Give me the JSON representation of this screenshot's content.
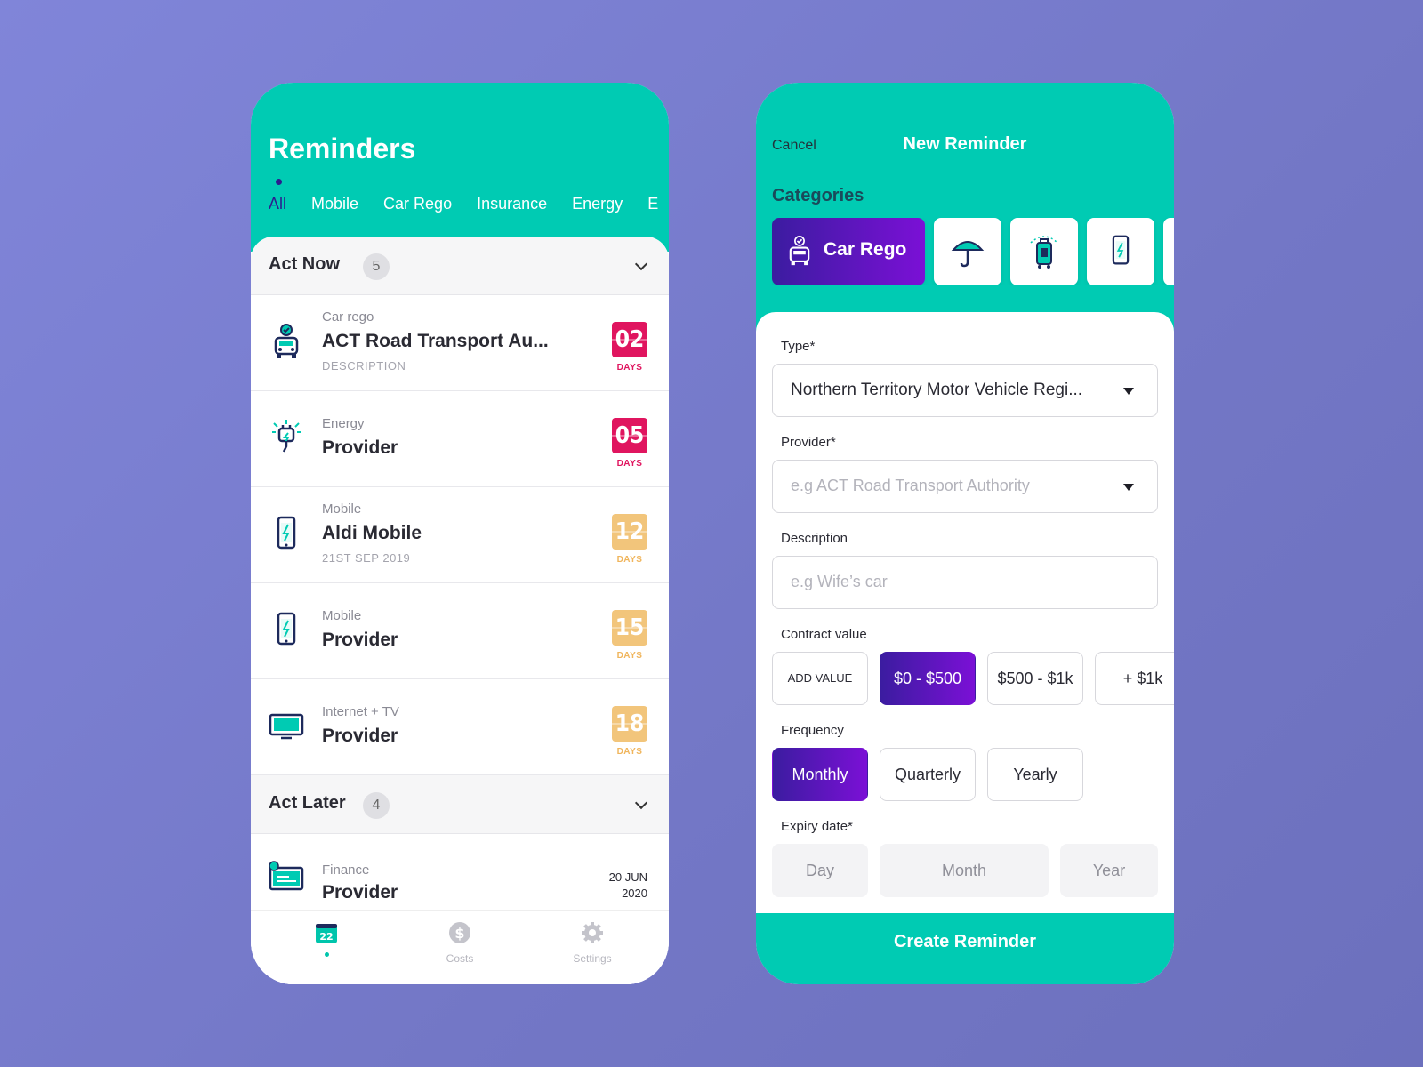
{
  "left": {
    "title": "Reminders",
    "tabs": [
      "All",
      "Mobile",
      "Car Rego",
      "Insurance",
      "Energy",
      "E"
    ],
    "act_now": {
      "title": "Act Now",
      "count": "5"
    },
    "act_later": {
      "title": "Act Later",
      "count": "4"
    },
    "rows": [
      {
        "category": "Car rego",
        "title": "ACT Road Transport Au...",
        "subtitle": "DESCRIPTION",
        "days": "02",
        "days_label": "DAYS"
      },
      {
        "category": "Energy",
        "title": "Provider",
        "days": "05",
        "days_label": "DAYS"
      },
      {
        "category": "Mobile",
        "title": "Aldi Mobile",
        "subtitle": "21ST SEP 2019",
        "days": "12",
        "days_label": "DAYS"
      },
      {
        "category": "Mobile",
        "title": "Provider",
        "days": "15",
        "days_label": "DAYS"
      },
      {
        "category": "Internet + TV",
        "title": "Provider",
        "days": "18",
        "days_label": "DAYS"
      }
    ],
    "later_row": {
      "category": "Finance",
      "title": "Provider",
      "date_line1": "20 JUN",
      "date_line2": "2020"
    },
    "nav": {
      "home_badge": "22",
      "costs": "Costs",
      "settings": "Settings"
    },
    "icons": [
      "car-icon",
      "plug-icon",
      "phone-icon",
      "phone-icon",
      "tv-icon",
      "finance-card-icon"
    ]
  },
  "right": {
    "cancel": "Cancel",
    "title": "New Reminder",
    "categories_label": "Categories",
    "selected_category": "Car Rego",
    "category_icons": [
      "car-icon",
      "umbrella-icon",
      "luggage-icon",
      "phone-icon"
    ],
    "type_label": "Type*",
    "type_value": "Northern Territory Motor Vehicle Regi...",
    "provider_label": "Provider*",
    "provider_placeholder": "e.g ACT Road Transport Authority",
    "description_label": "Description",
    "description_placeholder": "e.g Wife’s car",
    "contract_label": "Contract value",
    "contract_options": [
      "ADD VALUE",
      "$0 - $500",
      "$500 - $1k",
      "+ $1k"
    ],
    "contract_selected": "$0 - $500",
    "frequency_label": "Frequency",
    "frequency_options": [
      "Monthly",
      "Quarterly",
      "Yearly"
    ],
    "frequency_selected": "Monthly",
    "expiry_label": "Expiry date*",
    "expiry_fields": [
      "Day",
      "Month",
      "Year"
    ],
    "create_button": "Create Reminder"
  },
  "colors": {
    "teal": "#00cbb3",
    "purple_start": "#3b1ca0",
    "purple_end": "#7b10d6",
    "urgent": "#e0155f",
    "soon": "#f2c57b",
    "background": "#7b7fd2"
  }
}
